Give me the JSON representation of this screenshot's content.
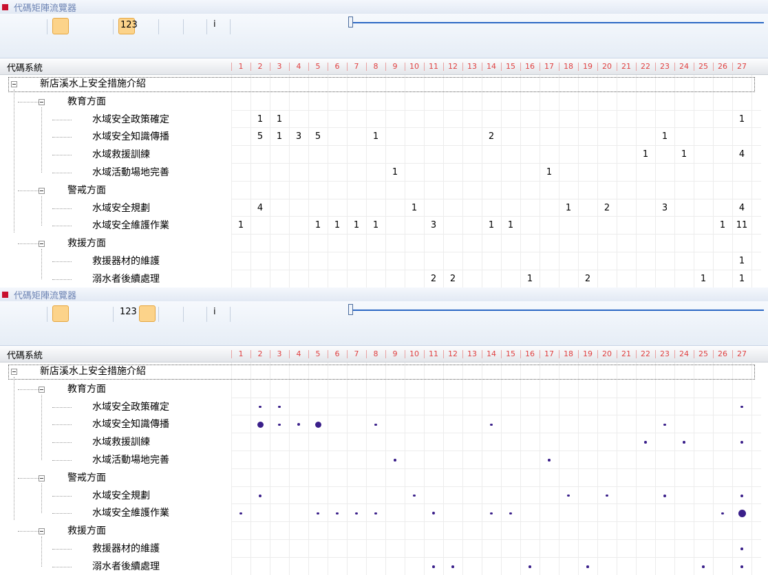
{
  "window": {
    "title": "代碼矩陣流覽器"
  },
  "toolbar": {
    "buttons": [
      {
        "name": "export-icon"
      },
      {
        "name": "screenshot-icon"
      },
      {
        "name": "layout-split-icon",
        "active": true
      },
      {
        "name": "layout-columns-icon"
      },
      {
        "name": "layout-single-icon"
      },
      {
        "name": "numbers-icon",
        "active": true
      },
      {
        "name": "symbols-icon"
      },
      {
        "name": "copy-icon"
      },
      {
        "name": "refresh-icon"
      },
      {
        "name": "info-icon"
      },
      {
        "name": "run-icon"
      }
    ],
    "slider": {
      "value": 0
    }
  },
  "header": {
    "code_system_label": "代碼系統",
    "columns": [
      "1",
      "2",
      "3",
      "4",
      "5",
      "6",
      "7",
      "8",
      "9",
      "10",
      "11",
      "12",
      "13",
      "14",
      "15",
      "16",
      "17",
      "18",
      "19",
      "20",
      "21",
      "22",
      "23",
      "24",
      "25",
      "26",
      "27"
    ]
  },
  "rows": [
    {
      "label": "新店溪水上安全措施介紹",
      "level": 0,
      "values": []
    },
    {
      "label": "教育方面",
      "level": 1,
      "values": []
    },
    {
      "label": "水域安全政策確定",
      "level": 2,
      "values": [
        [
          2,
          1
        ],
        [
          3,
          1
        ],
        [
          27,
          1
        ]
      ]
    },
    {
      "label": "水域安全知識傳播",
      "level": 2,
      "values": [
        [
          2,
          5
        ],
        [
          3,
          1
        ],
        [
          4,
          3
        ],
        [
          5,
          5
        ],
        [
          8,
          1
        ],
        [
          14,
          2
        ],
        [
          23,
          1
        ]
      ]
    },
    {
      "label": "水域救援訓練",
      "level": 2,
      "values": [
        [
          22,
          1
        ],
        [
          24,
          1
        ],
        [
          27,
          4
        ]
      ]
    },
    {
      "label": "水域活動場地完善",
      "level": 2,
      "values": [
        [
          9,
          1
        ],
        [
          17,
          1
        ]
      ]
    },
    {
      "label": "警戒方面",
      "level": 1,
      "values": []
    },
    {
      "label": "水域安全規劃",
      "level": 2,
      "values": [
        [
          2,
          4
        ],
        [
          10,
          1
        ],
        [
          18,
          1
        ],
        [
          20,
          2
        ],
        [
          23,
          3
        ],
        [
          27,
          4
        ]
      ]
    },
    {
      "label": "水域安全維護作業",
      "level": 2,
      "values": [
        [
          1,
          1
        ],
        [
          5,
          1
        ],
        [
          6,
          1
        ],
        [
          7,
          1
        ],
        [
          8,
          1
        ],
        [
          11,
          3
        ],
        [
          14,
          1
        ],
        [
          15,
          1
        ],
        [
          26,
          1
        ],
        [
          27,
          11
        ]
      ]
    },
    {
      "label": "救援方面",
      "level": 1,
      "values": []
    },
    {
      "label": "救援器材的維護",
      "level": 2,
      "values": [
        [
          27,
          1
        ]
      ]
    },
    {
      "label": "溺水者後續處理",
      "level": 2,
      "values": [
        [
          11,
          2
        ],
        [
          12,
          2
        ],
        [
          16,
          1
        ],
        [
          19,
          2
        ],
        [
          25,
          1
        ],
        [
          27,
          1
        ]
      ]
    }
  ],
  "panels": [
    {
      "mode": "numbers"
    },
    {
      "mode": "symbols"
    }
  ],
  "colors": {
    "dot": "#3a1f8a",
    "header_num": "#e04040",
    "active_btn": "#fcd38a",
    "title": "#6d84b4"
  }
}
